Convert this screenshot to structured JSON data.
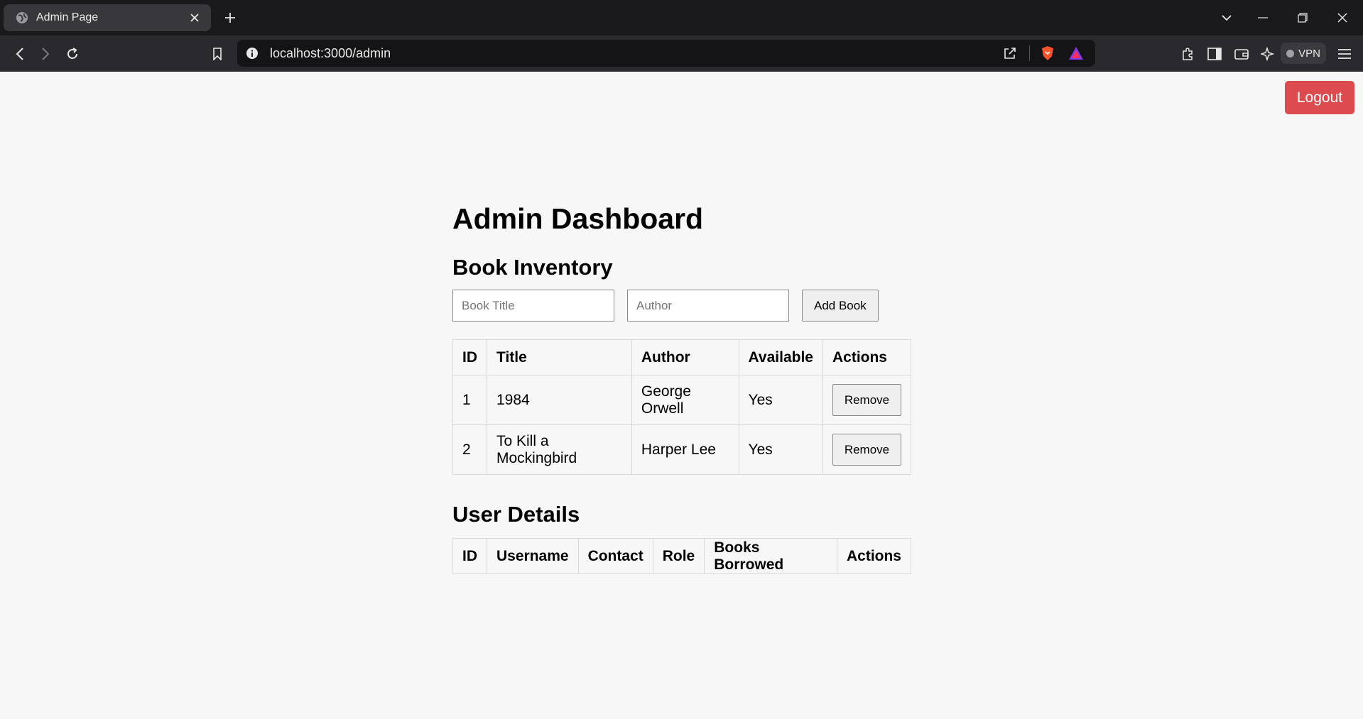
{
  "browser": {
    "tab_title": "Admin Page",
    "url": "localhost:3000/admin",
    "vpn_label": "VPN"
  },
  "page": {
    "logout_label": "Logout",
    "title": "Admin Dashboard",
    "inventory": {
      "heading": "Book Inventory",
      "title_placeholder": "Book Title",
      "author_placeholder": "Author",
      "add_label": "Add Book",
      "columns": [
        "ID",
        "Title",
        "Author",
        "Available",
        "Actions"
      ],
      "rows": [
        {
          "id": "1",
          "title": "1984",
          "author": "George Orwell",
          "available": "Yes",
          "action": "Remove"
        },
        {
          "id": "2",
          "title": "To Kill a Mockingbird",
          "author": "Harper Lee",
          "available": "Yes",
          "action": "Remove"
        }
      ]
    },
    "users": {
      "heading": "User Details",
      "columns": [
        "ID",
        "Username",
        "Contact",
        "Role",
        "Books Borrowed",
        "Actions"
      ]
    }
  },
  "colors": {
    "logout_bg": "#dc4b4e",
    "page_bg": "#f7f7f7"
  }
}
